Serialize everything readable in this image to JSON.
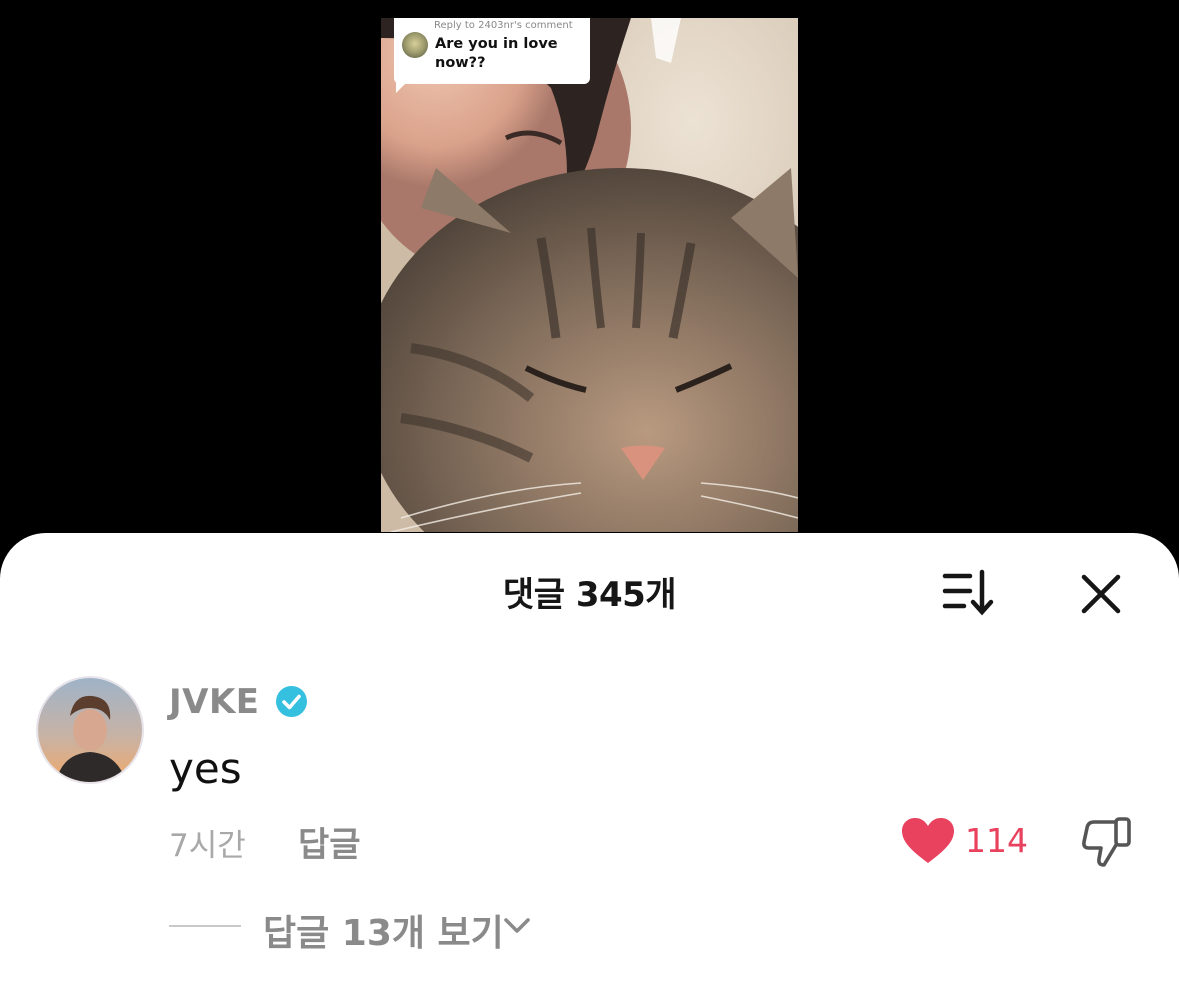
{
  "video": {
    "reply_header": "Reply to 2403nr's comment",
    "reply_text": "Are you in love now??"
  },
  "sheet": {
    "title": "댓글 345개"
  },
  "comment": {
    "username": "JVKE",
    "text": "yes",
    "time": "7시간",
    "reply_label": "답글",
    "like_count": "114",
    "view_replies_label": "답글 13개 보기"
  },
  "colors": {
    "like": "#e8425f",
    "verified": "#35c0e0",
    "muted_text": "#8a8a8a"
  },
  "icons": [
    "sort-icon",
    "close-icon",
    "verified-badge-icon",
    "heart-icon",
    "dislike-icon",
    "chevron-down-icon"
  ]
}
